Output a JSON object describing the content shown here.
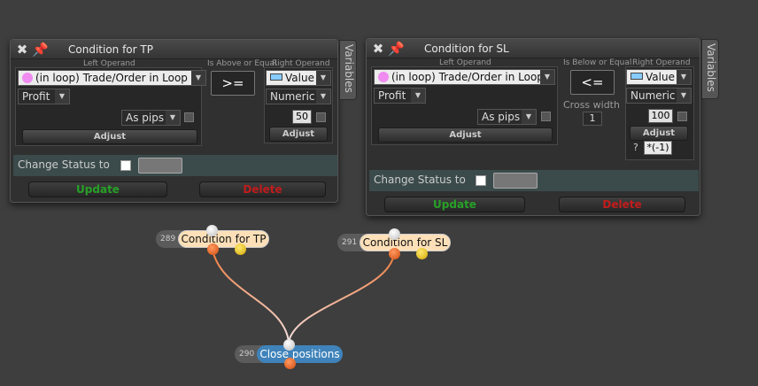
{
  "panels": {
    "tp": {
      "title": "Condition for TP",
      "vars_tab": "Variables",
      "left_label": "Left Operand",
      "left_source": "(in loop) Trade/Order in Loop",
      "left_field": "Profit",
      "left_unit": "As pips",
      "left_adjust": "Adjust",
      "op_label": "Is Above or Equal",
      "operator": ">=",
      "right_label": "Right Operand",
      "right_type": "Value",
      "right_format": "Numeric",
      "right_value": "50",
      "right_adjust": "Adjust",
      "status_label": "Change Status to",
      "update": "Update",
      "delete": "Delete"
    },
    "sl": {
      "title": "Condition for SL",
      "vars_tab": "Variables",
      "left_label": "Left Operand",
      "left_source": "(in loop) Trade/Order in Loop",
      "left_field": "Profit",
      "left_unit": "As pips",
      "left_adjust": "Adjust",
      "op_label": "Is Below or Equal",
      "operator": "<=",
      "cross_label": "Cross width",
      "cross_value": "1",
      "right_label": "Right Operand",
      "right_type": "Value",
      "right_format": "Numeric",
      "right_value": "100",
      "right_adjust": "Adjust",
      "right_q": "?",
      "right_mult": "*(-1)",
      "status_label": "Change Status to",
      "update": "Update",
      "delete": "Delete"
    }
  },
  "nodes": {
    "tp": {
      "id": "289",
      "label": "Condition for TP"
    },
    "sl": {
      "id": "291",
      "label": "Condition for SL"
    },
    "close": {
      "id": "290",
      "label": "Close positions"
    }
  },
  "icons": {
    "close": "close-icon",
    "pin": "pin-icon"
  },
  "colors": {
    "update": "#27a127",
    "delete": "#c21c1c",
    "wire": "#f07a3a",
    "node_close": "#3f83ba",
    "node_condition": "#fde0b8"
  }
}
